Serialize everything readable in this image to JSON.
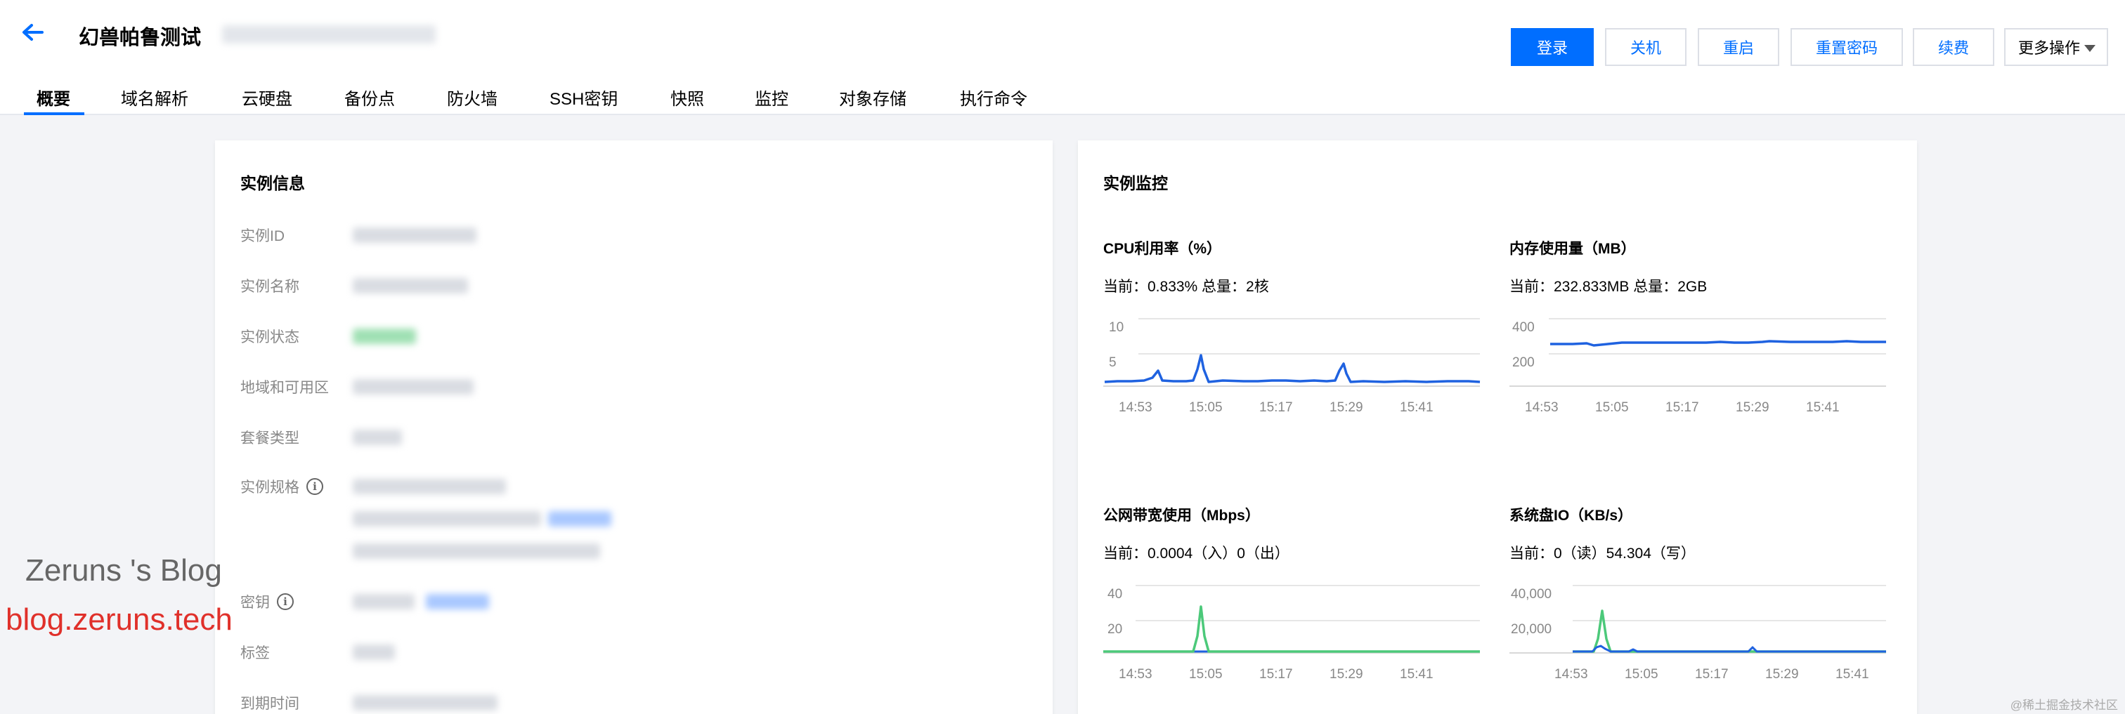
{
  "header": {
    "title": "幻兽帕鲁测试",
    "buttons": {
      "login": "登录",
      "shutdown": "关机",
      "restart": "重启",
      "reset_password": "重置密码",
      "renew": "续费",
      "more": "更多操作"
    },
    "tabs": [
      "概要",
      "域名解析",
      "云硬盘",
      "备份点",
      "防火墙",
      "SSH密钥",
      "快照",
      "监控",
      "对象存储",
      "执行命令"
    ]
  },
  "instance_info": {
    "title": "实例信息",
    "labels": {
      "id": "实例ID",
      "name": "实例名称",
      "status": "实例状态",
      "region": "地域和可用区",
      "package": "套餐类型",
      "spec": "实例规格",
      "key": "密钥",
      "tag": "标签",
      "expire": "到期时间"
    },
    "spec_info_glyph": "i",
    "key_info_glyph": "i"
  },
  "monitor": {
    "title": "实例监控",
    "x_ticks": [
      "14:53",
      "15:05",
      "15:17",
      "15:29",
      "15:41"
    ],
    "cpu": {
      "title": "CPU利用率（%）",
      "current": "当前：0.833% 总量：2核",
      "y_ticks": [
        "10",
        "5"
      ]
    },
    "memory": {
      "title": "内存使用量（MB）",
      "current": "当前：232.833MB 总量：2GB",
      "y_ticks": [
        "400",
        "200"
      ]
    },
    "bandwidth": {
      "title": "公网带宽使用（Mbps）",
      "current": "当前：0.0004（入）0（出）",
      "y_ticks": [
        "40",
        "20"
      ]
    },
    "disk_io": {
      "title": "系统盘IO（KB/s）",
      "current": "当前：0（读）54.304（写）",
      "y_ticks": [
        "40,000",
        "20,000"
      ]
    }
  },
  "watermark": {
    "line1": "Zeruns 's Blog",
    "line2": "blog.zeruns.tech",
    "corner": "@稀土掘金技术社区"
  },
  "colors": {
    "accent": "#006eff",
    "series_blue": "#1f62e0",
    "series_green": "#4cc97a",
    "muted_text": "#888888"
  }
}
